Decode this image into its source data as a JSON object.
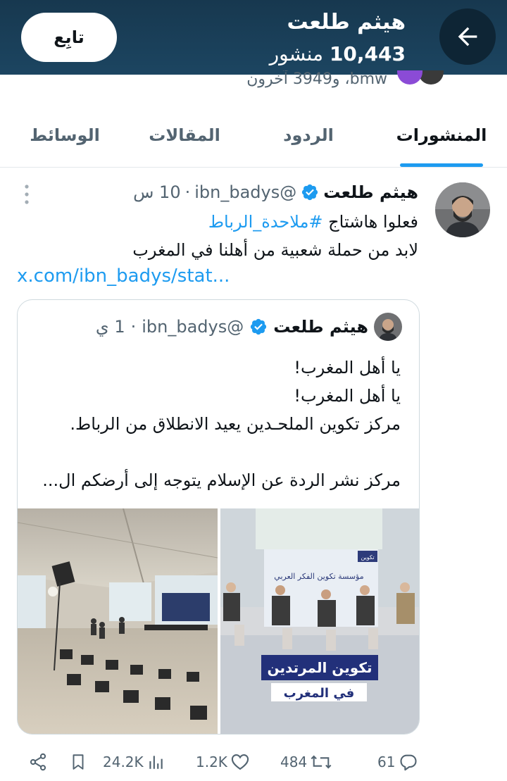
{
  "header": {
    "name": "هيثم طلعت",
    "post_count": "10,443",
    "post_count_label": "منشور",
    "follow_label": "تابِع",
    "back_icon": "arrow-left-icon"
  },
  "followers_strip": {
    "text": "bmw، و3949 آخرون"
  },
  "tabs": [
    {
      "label": "المنشورات",
      "active": true
    },
    {
      "label": "الردود",
      "active": false
    },
    {
      "label": "المقالات",
      "active": false
    },
    {
      "label": "الوسائط",
      "active": false
    }
  ],
  "tweet": {
    "name": "هيثم طلعت",
    "handle": "@ibn_badys",
    "time": "10 س",
    "separator": "·",
    "line1_prefix": "فعلوا هاشتاج",
    "hashtag": "#ملاحدة_الرباط",
    "line2": "لابد من حملة شعبية من أهلنا في المغرب",
    "link": "x.com/ibn_badys/stat..."
  },
  "quote": {
    "name": "هيثم طلعت",
    "handle": "@ibn_badys",
    "time": "1 ي",
    "separator": "·",
    "text": "يا أهل المغرب!\nيا أهل المغرب!\nمركز تكوين الملحـدين يعيد الانطلاق من الرباط.\n\nمركز نشر الردة عن الإسلام يتوجه إلى أرضكم ال..."
  },
  "media_right": {
    "banner_line1": "تكوين المرتدين",
    "banner_line2": "في المغرب",
    "backdrop_text": "مؤسسة تكوين الفكر العربي",
    "logo_text": "تكوين"
  },
  "actions": {
    "replies": "61",
    "reposts": "484",
    "likes": "1.2K",
    "views": "24.2K"
  },
  "colors": {
    "header_bg": "#17384f",
    "accent": "#1d9bf0",
    "muted": "#536471"
  }
}
